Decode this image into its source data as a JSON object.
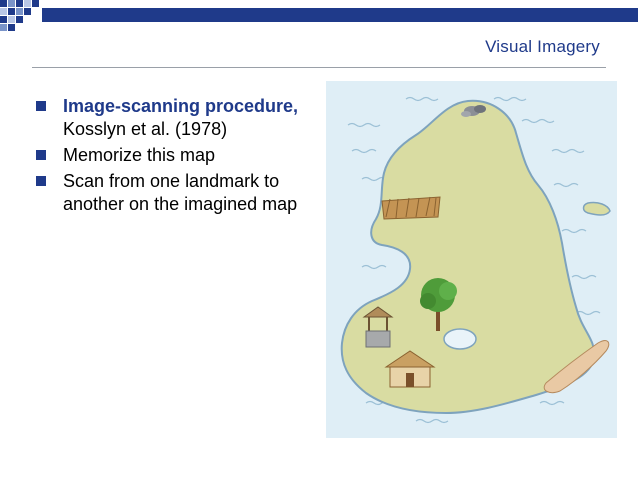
{
  "slide": {
    "title": "Visual Imagery",
    "bullets": [
      {
        "emphasis": "Image-scanning procedure,",
        "text": " Kosslyn et al. (1978)"
      },
      {
        "text": "Memorize this map"
      },
      {
        "text": "Scan from one landmark to another on the imagined map"
      }
    ]
  },
  "colors": {
    "title": "#1f3a8a",
    "bullet": "#1f3a8a",
    "sea": "#dfeef6",
    "land": "#d9dca2",
    "coast": "#7ea3bd"
  },
  "map": {
    "landmarks": [
      "hut-icon",
      "tree-icon",
      "well-icon",
      "grass-patch-icon",
      "rocks-icon",
      "beach-icon",
      "lake-icon"
    ]
  }
}
